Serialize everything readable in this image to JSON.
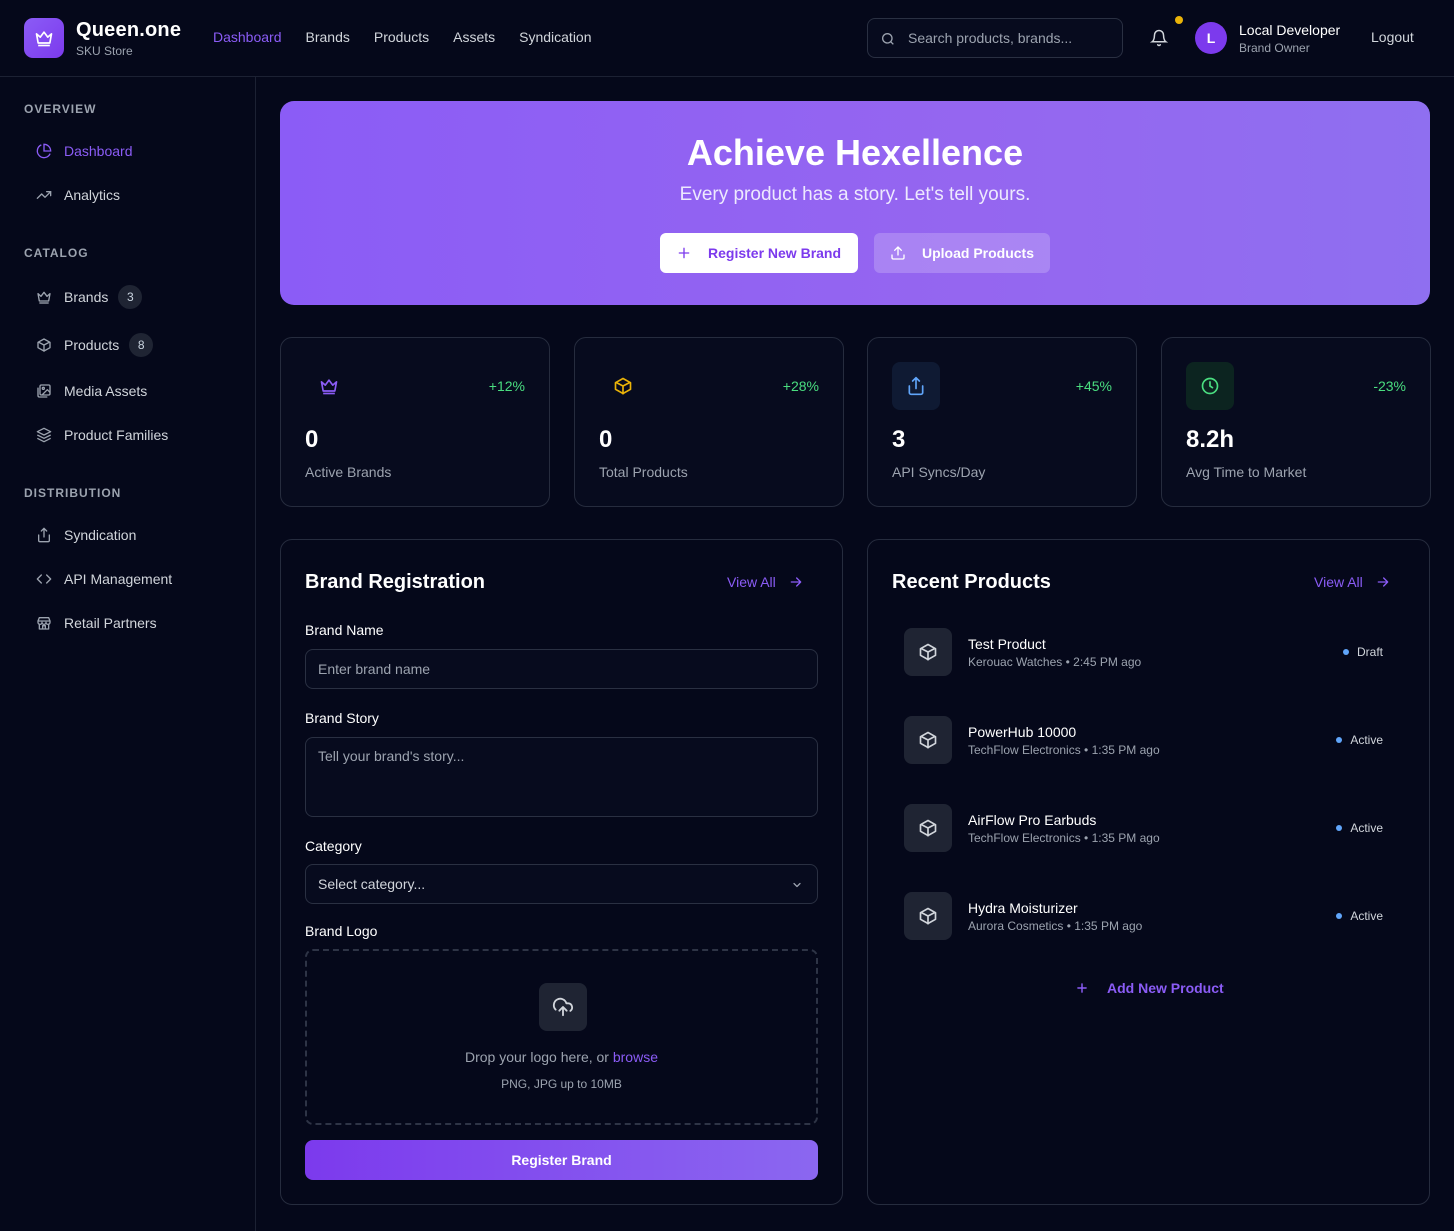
{
  "header": {
    "app_name": "Queen.one",
    "app_sub": "SKU Store",
    "nav": [
      {
        "label": "Dashboard",
        "active": true
      },
      {
        "label": "Brands"
      },
      {
        "label": "Products"
      },
      {
        "label": "Assets"
      },
      {
        "label": "Syndication"
      }
    ],
    "search_placeholder": "Search products, brands...",
    "user": {
      "initial": "L",
      "name": "Local Developer",
      "role": "Brand Owner"
    },
    "logout": "Logout"
  },
  "sidebar": {
    "sections": [
      {
        "title": "OVERVIEW",
        "items": [
          {
            "label": "Dashboard",
            "icon": "pie-chart-icon",
            "active": true
          },
          {
            "label": "Analytics",
            "icon": "trending-up-icon"
          }
        ]
      },
      {
        "title": "CATALOG",
        "items": [
          {
            "label": "Brands",
            "icon": "crown-icon",
            "count": "3"
          },
          {
            "label": "Products",
            "icon": "box-icon",
            "count": "8"
          },
          {
            "label": "Media Assets",
            "icon": "images-icon"
          },
          {
            "label": "Product Families",
            "icon": "layers-icon"
          }
        ]
      },
      {
        "title": "DISTRIBUTION",
        "items": [
          {
            "label": "Syndication",
            "icon": "share-icon"
          },
          {
            "label": "API Management",
            "icon": "code-icon"
          },
          {
            "label": "Retail Partners",
            "icon": "store-icon"
          }
        ]
      }
    ]
  },
  "hero": {
    "title": "Achieve Hexellence",
    "subtitle": "Every product has a story. Let's tell yours.",
    "primary_button": "Register New Brand",
    "secondary_button": "Upload Products"
  },
  "stats": [
    {
      "value": "0",
      "label": "Active Brands",
      "delta": "+12%",
      "icon": "crown-icon",
      "color": "#8b5cf6"
    },
    {
      "value": "0",
      "label": "Total Products",
      "delta": "+28%",
      "icon": "box-icon",
      "color": "#eab308"
    },
    {
      "value": "3",
      "label": "API Syncs/Day",
      "delta": "+45%",
      "icon": "share-icon",
      "color": "#60a5fa"
    },
    {
      "value": "8.2h",
      "label": "Avg Time to Market",
      "delta": "-23%",
      "icon": "clock-icon",
      "color": "#4ade80"
    }
  ],
  "brand_registration": {
    "title": "Brand Registration",
    "view_all": "View All",
    "name_label": "Brand Name",
    "name_placeholder": "Enter brand name",
    "story_label": "Brand Story",
    "story_placeholder": "Tell your brand's story...",
    "category_label": "Category",
    "category_value": "Select category...",
    "logo_label": "Brand Logo",
    "drop_text": "Drop your logo here, or",
    "drop_browse": "browse",
    "drop_hint": "PNG, JPG up to 10MB",
    "submit": "Register Brand"
  },
  "recent_products": {
    "title": "Recent Products",
    "view_all": "View All",
    "items": [
      {
        "name": "Test Product",
        "brand": "Kerouac Watches",
        "time": "2:45 PM ago",
        "status": "Draft"
      },
      {
        "name": "PowerHub 10000",
        "brand": "TechFlow Electronics",
        "time": "1:35 PM ago",
        "status": "Active"
      },
      {
        "name": "AirFlow Pro Earbuds",
        "brand": "TechFlow Electronics",
        "time": "1:35 PM ago",
        "status": "Active"
      },
      {
        "name": "Hydra Moisturizer",
        "brand": "Aurora Cosmetics",
        "time": "1:35 PM ago",
        "status": "Active"
      }
    ],
    "add_new": "Add New Product"
  },
  "colors": {
    "accent": "#8b5cf6",
    "background": "#05081a",
    "positive": "#4ade80",
    "status_dot": "#60a5fa",
    "notification": "#eab308"
  }
}
